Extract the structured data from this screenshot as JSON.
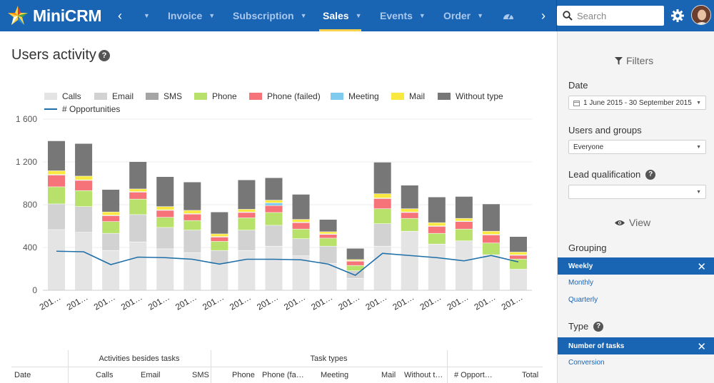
{
  "app": {
    "name": "MiniCRM"
  },
  "nav": {
    "prev_arrow": "‹",
    "next_arrow": "›",
    "items": [
      {
        "label": "Invoice",
        "active": false
      },
      {
        "label": "Subscription",
        "active": false
      },
      {
        "label": "Sales",
        "active": true
      },
      {
        "label": "Events",
        "active": false
      },
      {
        "label": "Order",
        "active": false
      }
    ],
    "accent": "#f7d24a"
  },
  "search": {
    "placeholder": "Search"
  },
  "page": {
    "title": "Users activity",
    "help": "?"
  },
  "colors": {
    "brand": "#1a64b4",
    "line": "#1f6fa8"
  },
  "chart_data": {
    "type": "bar",
    "stacked": true,
    "legend": [
      {
        "name": "Calls",
        "color": "#e4e4e4"
      },
      {
        "name": "Email",
        "color": "#d2d2d2"
      },
      {
        "name": "SMS",
        "color": "#a5a5a5"
      },
      {
        "name": "Phone",
        "color": "#b7e16b"
      },
      {
        "name": "Phone (failed)",
        "color": "#f6737a"
      },
      {
        "name": "Meeting",
        "color": "#7ecbef"
      },
      {
        "name": "Mail",
        "color": "#f8e83f"
      },
      {
        "name": "Without type",
        "color": "#777777"
      },
      {
        "name": "# Opportunities",
        "color": "#1f6fa8"
      }
    ],
    "ylim": [
      0,
      1600
    ],
    "yticks": [
      "0",
      "400",
      "800",
      "1 200",
      "1 600"
    ],
    "grid": true,
    "legend_position": "top-left",
    "categories": [
      "201…",
      "201…",
      "201…",
      "201…",
      "201…",
      "201…",
      "201…",
      "201…",
      "201…",
      "201…",
      "201…",
      "201…",
      "201…",
      "201…",
      "201…",
      "201…",
      "201…",
      "201…"
    ],
    "series": [
      {
        "name": "Calls",
        "values": [
          565,
          540,
          370,
          450,
          385,
          350,
          240,
          370,
          410,
          320,
          250,
          110,
          410,
          550,
          430,
          460,
          330,
          195
        ]
      },
      {
        "name": "Email",
        "values": [
          240,
          240,
          160,
          255,
          200,
          210,
          130,
          190,
          195,
          160,
          160,
          70,
          210,
          0,
          0,
          0,
          0,
          0
        ]
      },
      {
        "name": "SMS",
        "values": [
          0,
          0,
          0,
          0,
          0,
          0,
          0,
          0,
          0,
          0,
          0,
          0,
          0,
          0,
          0,
          0,
          0,
          0
        ]
      },
      {
        "name": "Phone",
        "values": [
          160,
          150,
          110,
          145,
          95,
          90,
          85,
          115,
          120,
          90,
          75,
          50,
          140,
          120,
          100,
          110,
          110,
          95
        ]
      },
      {
        "name": "Phone (failed)",
        "values": [
          110,
          95,
          55,
          65,
          65,
          60,
          40,
          50,
          65,
          60,
          35,
          40,
          95,
          55,
          65,
          70,
          75,
          35
        ]
      },
      {
        "name": "Meeting",
        "values": [
          5,
          5,
          5,
          5,
          5,
          5,
          5,
          5,
          25,
          5,
          5,
          5,
          5,
          5,
          5,
          5,
          5,
          5
        ]
      },
      {
        "name": "Mail",
        "values": [
          35,
          35,
          30,
          25,
          30,
          30,
          25,
          25,
          25,
          25,
          20,
          10,
          40,
          30,
          30,
          25,
          30,
          25
        ]
      },
      {
        "name": "Without type",
        "values": [
          280,
          305,
          210,
          255,
          280,
          265,
          205,
          275,
          210,
          235,
          115,
          105,
          295,
          220,
          240,
          205,
          255,
          145
        ]
      }
    ],
    "line": {
      "name": "# Opportunities",
      "values": [
        365,
        360,
        240,
        310,
        305,
        290,
        245,
        290,
        290,
        285,
        245,
        140,
        345,
        325,
        305,
        275,
        325,
        265
      ]
    }
  },
  "table": {
    "groups": [
      {
        "label": "Activities besides tasks"
      },
      {
        "label": "Task types"
      }
    ],
    "columns": [
      "Date",
      "Calls",
      "Email",
      "SMS",
      "Phone",
      "Phone (fa…",
      "Meeting",
      "Mail",
      "Without t…",
      "# Opport…",
      "Total"
    ]
  },
  "sidebar": {
    "filters_title": "Filters",
    "date_label": "Date",
    "date_value": "1 June 2015 - 30 September 2015",
    "users_label": "Users and groups",
    "users_value": "Everyone",
    "lead_label": "Lead qualification",
    "lead_value": "",
    "help": "?",
    "view_title": "View",
    "grouping_label": "Grouping",
    "grouping_selected": "Weekly",
    "grouping_options": [
      "Monthly",
      "Quarterly"
    ],
    "type_label": "Type",
    "type_selected": "Number of tasks",
    "type_options": [
      "Conversion"
    ],
    "remove": "✕"
  }
}
